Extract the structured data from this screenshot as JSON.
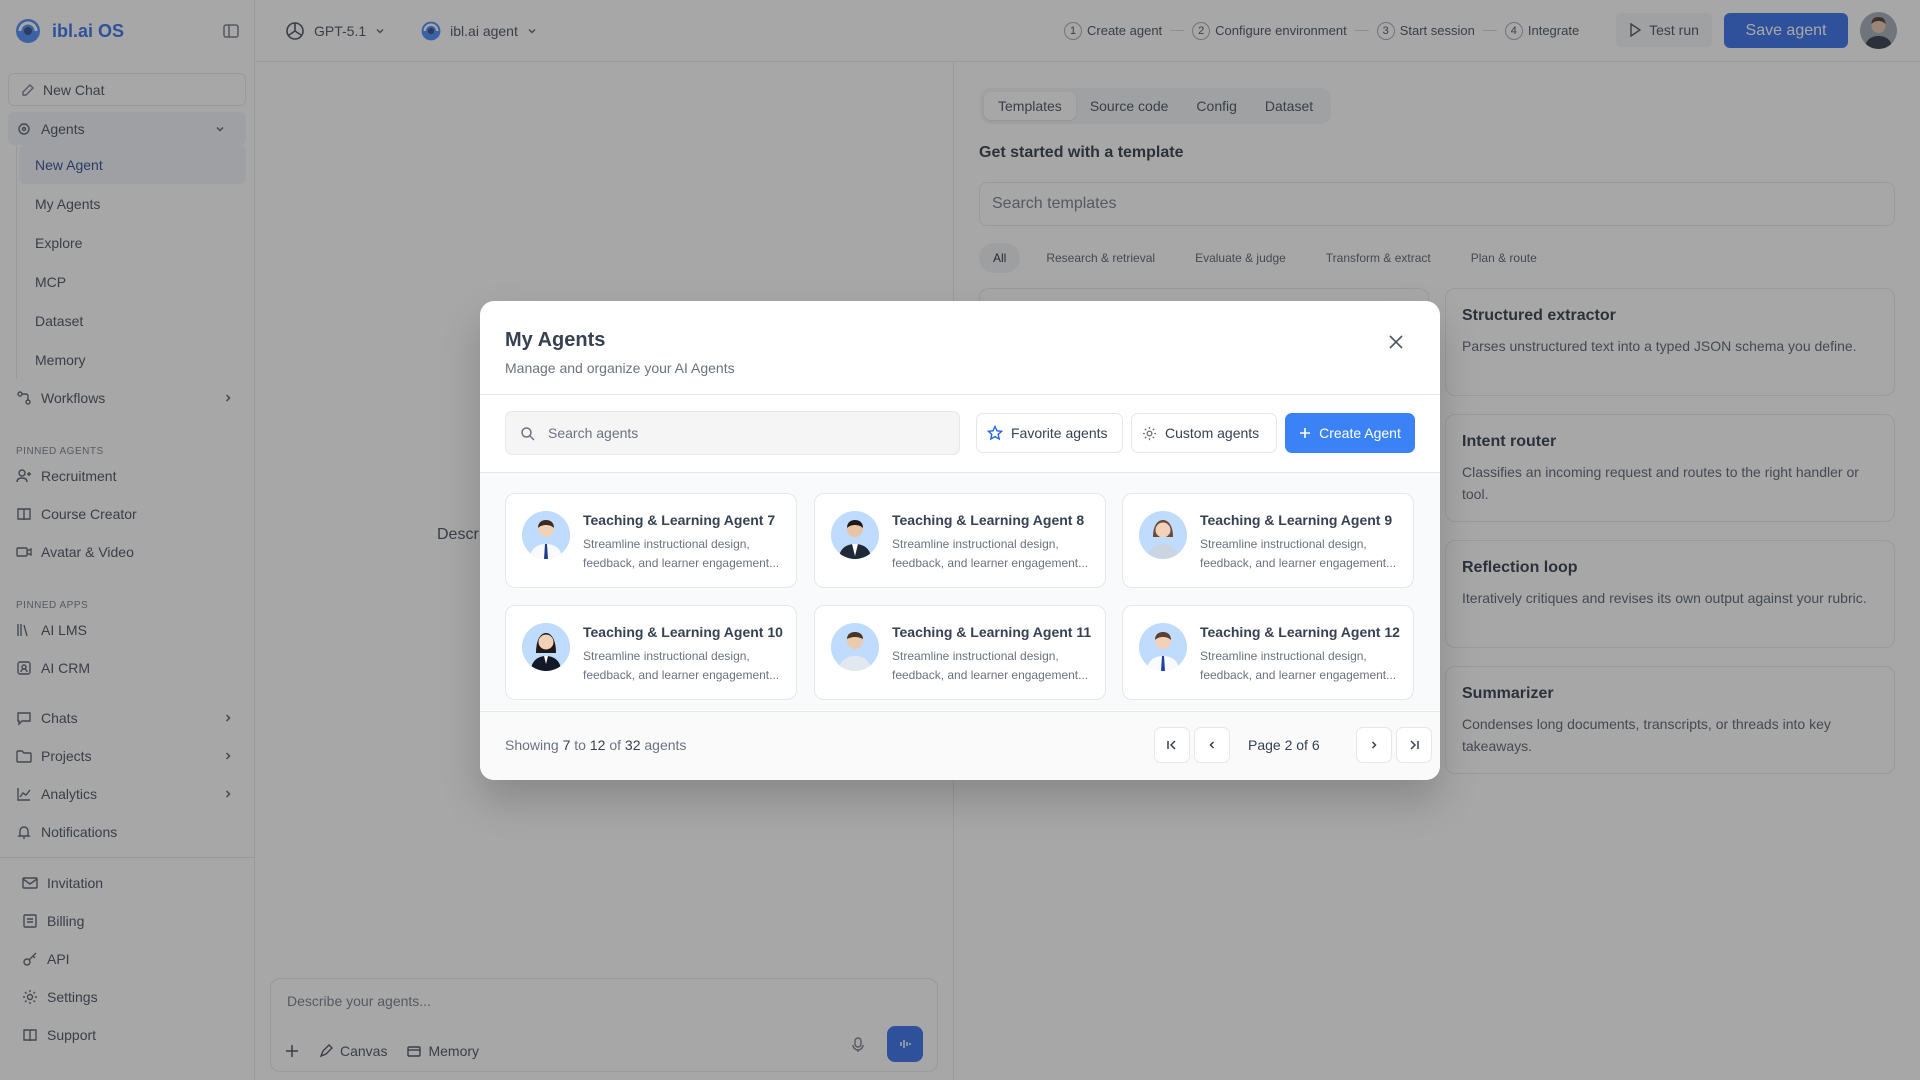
{
  "app": {
    "name": "ibl.ai OS"
  },
  "sidebar": {
    "new_chat": "New Chat",
    "agents_label": "Agents",
    "agents_sub": [
      "New Agent",
      "My Agents",
      "Explore",
      "MCP",
      "Dataset",
      "Memory"
    ],
    "workflows": "Workflows",
    "pinned_agents_label": "PINNED AGENTS",
    "pinned_agents": [
      "Recruitment",
      "Course Creator",
      "Avatar & Video"
    ],
    "pinned_apps_label": "PINNED APPS",
    "pinned_apps": [
      "AI LMS",
      "AI CRM"
    ],
    "chats": "Chats",
    "projects": "Projects",
    "analytics": "Analytics",
    "notifications": "Notifications",
    "bottom": [
      "Invitation",
      "Billing",
      "API",
      "Settings",
      "Support"
    ]
  },
  "topbar": {
    "model": "GPT-5.1",
    "agent": "ibl.ai agent",
    "steps": [
      {
        "num": "1",
        "label": "Create agent"
      },
      {
        "num": "2",
        "label": "Configure environment"
      },
      {
        "num": "3",
        "label": "Start session"
      },
      {
        "num": "4",
        "label": "Integrate"
      }
    ],
    "test_run": "Test run",
    "save_agent": "Save agent"
  },
  "left_panel": {
    "describe_peek": "Descr",
    "composer_placeholder": "Describe your agents...",
    "canvas": "Canvas",
    "memory": "Memory"
  },
  "right_panel": {
    "tabs": [
      "Templates",
      "Source code",
      "Config",
      "Dataset"
    ],
    "title": "Get started with a template",
    "search_placeholder": "Search templates",
    "chips": [
      "All",
      "Research & retrieval",
      "Evaluate & judge",
      "Transform & extract",
      "Plan & route"
    ],
    "templates": [
      {
        "name": "Structured extractor",
        "desc": "Parses unstructured text into a typed JSON schema you define."
      },
      {
        "name": "Intent router",
        "desc": "Classifies an incoming request and routes to the right handler or tool."
      },
      {
        "name": "Reflection loop",
        "desc": "Iteratively critiques and revises its own output against your rubric."
      },
      {
        "name": "Summarizer",
        "desc": "Condenses long documents, transcripts, or threads into key takeaways."
      }
    ]
  },
  "modal": {
    "title": "My Agents",
    "subtitle": "Manage and organize your AI Agents",
    "search_placeholder": "Search agents",
    "favorite": "Favorite agents",
    "custom": "Custom agents",
    "create": "Create Agent",
    "agents": [
      {
        "name": "Teaching & Learning Agent 7",
        "desc": "Streamline instructional design, feedback, and learner engagement..."
      },
      {
        "name": "Teaching & Learning Agent 8",
        "desc": "Streamline instructional design, feedback, and learner engagement..."
      },
      {
        "name": "Teaching & Learning Agent 9",
        "desc": "Streamline instructional design, feedback, and learner engagement..."
      },
      {
        "name": "Teaching & Learning Agent 10",
        "desc": "Streamline instructional design, feedback, and learner engagement..."
      },
      {
        "name": "Teaching & Learning Agent 11",
        "desc": "Streamline instructional design, feedback, and learner engagement..."
      },
      {
        "name": "Teaching & Learning Agent 12",
        "desc": "Streamline instructional design, feedback, and learner engagement..."
      }
    ],
    "pagination": {
      "showing_prefix": "Showing",
      "from": "7",
      "to_word": "to",
      "to": "12",
      "of_word": "of",
      "total": "32",
      "suffix": "agents",
      "page_text": "Page 2 of 6"
    }
  },
  "colors": {
    "accent": "#2563eb",
    "create_button": "#3b82f6",
    "overlay": "rgba(60,60,60,0.45)"
  }
}
